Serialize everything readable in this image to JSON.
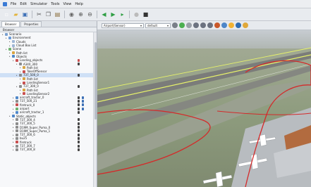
{
  "menu": [
    "File",
    "Edit",
    "Simulator",
    "Tools",
    "View",
    "Help"
  ],
  "toolbar": {
    "buttons": [
      {
        "name": "new-file-icon",
        "glyph": "▫",
        "color": "#ffffff"
      },
      {
        "name": "open-folder-icon",
        "glyph": "▰",
        "color": "#e2b33c"
      },
      {
        "name": "save-icon",
        "glyph": "▣",
        "color": "#3b6fb6"
      },
      {
        "name": "cut-icon",
        "glyph": "✂",
        "color": "#555555"
      },
      {
        "name": "copy-icon",
        "glyph": "❐",
        "color": "#555555"
      },
      {
        "name": "paste-icon",
        "glyph": "▤",
        "color": "#8a6d3b"
      },
      {
        "name": "settings-icon",
        "glyph": "◉",
        "color": "#666666"
      },
      {
        "name": "zoom-in-icon",
        "glyph": "⊕",
        "color": "#555555"
      },
      {
        "name": "zoom-out-icon",
        "glyph": "⊖",
        "color": "#555555"
      },
      {
        "name": "rewind-icon",
        "glyph": "◀",
        "color": "#2f9e44"
      },
      {
        "name": "play-icon",
        "glyph": "▶",
        "color": "#2f9e44"
      },
      {
        "name": "step-icon",
        "glyph": "▸",
        "color": "#2f9e44"
      },
      {
        "name": "record-icon",
        "glyph": "●",
        "color": "#bbbbbb"
      },
      {
        "name": "stop-icon",
        "glyph": "■",
        "color": "#333333"
      }
    ]
  },
  "left_panel": {
    "tabs": [
      "Browser",
      "Properties"
    ],
    "tree_header": "Browser",
    "rows": [
      {
        "label": "Scenario",
        "level": 0,
        "icon_color": "#7aa0d0"
      },
      {
        "label": "Environment",
        "level": 1,
        "icon_color": "#6a9bd8"
      },
      {
        "label": "Clouds",
        "level": 2,
        "icon_color": "#9fb6d6"
      },
      {
        "label": "Cloud Box List",
        "level": 2,
        "icon_color": "#9fb6d6"
      },
      {
        "label": "Scene",
        "level": 1,
        "icon_color": "#6fb36f"
      },
      {
        "label": "Path list",
        "level": 2,
        "icon_color": "#d9a441"
      },
      {
        "label": "Objects",
        "level": 2,
        "icon_color": "#4f87c9"
      },
      {
        "label": "Landing_objects",
        "level": 3,
        "icon_color": "#c94f4f",
        "flags": [
          "#c94f4f"
        ]
      },
      {
        "label": "A340_300",
        "level": 4,
        "icon_color": "#8c8c8c",
        "flags": [
          "#444444"
        ]
      },
      {
        "label": "Path list",
        "level": 5,
        "icon_color": "#d9a441"
      },
      {
        "label": "TakeOffSensor",
        "level": 5,
        "icon_color": "#c94f4f"
      },
      {
        "label": "737_500_0",
        "level": 4,
        "icon_color": "#8c8c8c",
        "flags": [
          "#444444"
        ],
        "selected": true
      },
      {
        "label": "Path list",
        "level": 5,
        "icon_color": "#d9a441"
      },
      {
        "label": "LandingSensor1",
        "level": 5,
        "icon_color": "#c94f4f"
      },
      {
        "label": "737_300_0",
        "level": 4,
        "icon_color": "#8c8c8c",
        "flags": [
          "#444444"
        ]
      },
      {
        "label": "Path list",
        "level": 5,
        "icon_color": "#d9a441"
      },
      {
        "label": "LandingSensor2",
        "level": 5,
        "icon_color": "#c94f4f"
      },
      {
        "label": "aircraft_tractor_0",
        "level": 3,
        "icon_color": "#4f87c9",
        "flags": [
          "#444444",
          "#3b6fb6"
        ]
      },
      {
        "label": "737_500_21",
        "level": 3,
        "icon_color": "#8c8c8c",
        "flags": [
          "#444444",
          "#3b6fb6"
        ]
      },
      {
        "label": "firetruck_0",
        "level": 3,
        "icon_color": "#c94f4f",
        "flags": [
          "#444444",
          "#3b6fb6"
        ]
      },
      {
        "label": "airport",
        "level": 3,
        "icon_color": "#6fb36f",
        "flags": [
          "#444444",
          "#3b6fb6"
        ]
      },
      {
        "label": "aircraft_tractor_1",
        "level": 3,
        "icon_color": "#4f87c9",
        "flags": [
          "#444444"
        ]
      },
      {
        "label": "Static_objects",
        "level": 2,
        "icon_color": "#4f87c9"
      },
      {
        "label": "737_300_4",
        "level": 3,
        "icon_color": "#8c8c8c",
        "flags": [
          "#444444"
        ]
      },
      {
        "label": "737_300_5",
        "level": 3,
        "icon_color": "#8c8c8c",
        "flags": [
          "#444444"
        ]
      },
      {
        "label": "D19M_Super_Puma_0",
        "level": 3,
        "icon_color": "#8c8c8c",
        "flags": [
          "#444444"
        ]
      },
      {
        "label": "D19M_Super_Puma_1",
        "level": 3,
        "icon_color": "#8c8c8c",
        "flags": [
          "#444444"
        ]
      },
      {
        "label": "737_300_6",
        "level": 3,
        "icon_color": "#8c8c8c",
        "flags": [
          "#444444"
        ]
      },
      {
        "label": "bu25",
        "level": 3,
        "icon_color": "#8c8c8c",
        "flags": [
          "#444444"
        ]
      },
      {
        "label": "firetruck",
        "level": 3,
        "icon_color": "#c94f4f",
        "flags": [
          "#444444"
        ]
      },
      {
        "label": "737_300_7",
        "level": 3,
        "icon_color": "#8c8c8c",
        "flags": [
          "#444444"
        ]
      },
      {
        "label": "737_300_8",
        "level": 3,
        "icon_color": "#8c8c8c",
        "flags": [
          "#444444"
        ]
      }
    ]
  },
  "viewport": {
    "object_select": "Airport(Sensor)",
    "mode_select": "default",
    "icons": [
      {
        "name": "camera-icon",
        "color": "#7a7f88"
      },
      {
        "name": "globe-icon",
        "color": "#4caf50"
      },
      {
        "name": "target-icon",
        "color": "#9aa0a8"
      },
      {
        "name": "move-icon",
        "color": "#6c7280"
      },
      {
        "name": "rotate-icon",
        "color": "#6c7280"
      },
      {
        "name": "scale-icon",
        "color": "#6c7280"
      },
      {
        "name": "wing-icon",
        "color": "#c9582a"
      },
      {
        "name": "tower-icon",
        "color": "#4d86c8"
      },
      {
        "name": "sun-icon",
        "color": "#f2b233"
      },
      {
        "name": "lamp-icon",
        "color": "#2f6db3"
      },
      {
        "name": "light-icon",
        "color": "#e0a83a"
      }
    ]
  },
  "colors": {
    "sensor_line": "#d42a2a",
    "runway_line": "#e7f26a",
    "grass": "#8d9b7d",
    "runway": "#7b7c7a"
  }
}
